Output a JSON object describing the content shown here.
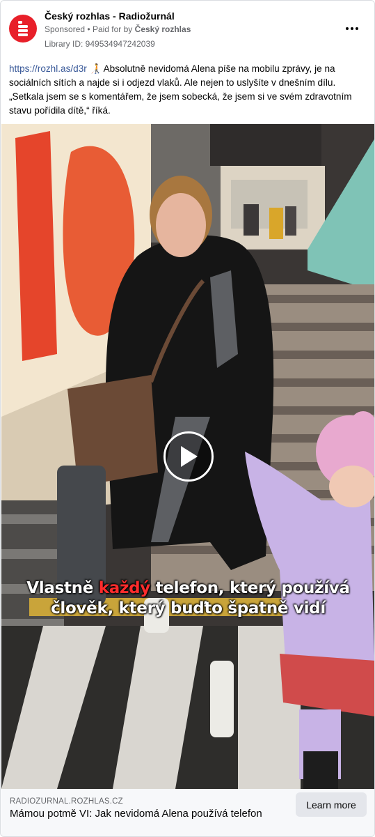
{
  "header": {
    "page_name": "Český rozhlas - Radiožurnál",
    "sponsored": "Sponsored",
    "separator": "•",
    "paid_for_by": "Paid for by",
    "sponsor": "Český rozhlas",
    "library_id": "Library ID: 949534947242039",
    "avatar_icon": "cesky-rozhlas-logo",
    "more_icon": "more-horizontal-icon"
  },
  "post": {
    "link": "https://rozhl.as/d3r",
    "emoji": "🧑‍🦯",
    "text": "Absolutně nevidomá Alena píše na mobilu zprávy, je na sociálních sítích a najde si i odjezd vlaků. Ale nejen to uslyšíte v dnešním dílu. „Setkala jsem se s komentářem, že jsem sobecká, že jsem si ve svém zdravotním stavu pořídila dítě,“ říká."
  },
  "video": {
    "caption_part1": "Vlastně ",
    "caption_highlight": "každý",
    "caption_part2": " telefon, který používá",
    "caption_line2": "člověk, který buďto špatně vidí",
    "play_icon": "play-icon",
    "caption_highlight_color": "#ff2c2c"
  },
  "footer": {
    "domain": "RADIOZURNAL.ROZHLAS.CZ",
    "headline": "Mámou potmě VI: Jak nevidomá Alena používá telefon",
    "cta": "Learn more"
  },
  "colors": {
    "brand_red": "#e8202a",
    "link": "#385898",
    "secondary_text": "#65676b",
    "button_bg": "#e4e6eb"
  }
}
